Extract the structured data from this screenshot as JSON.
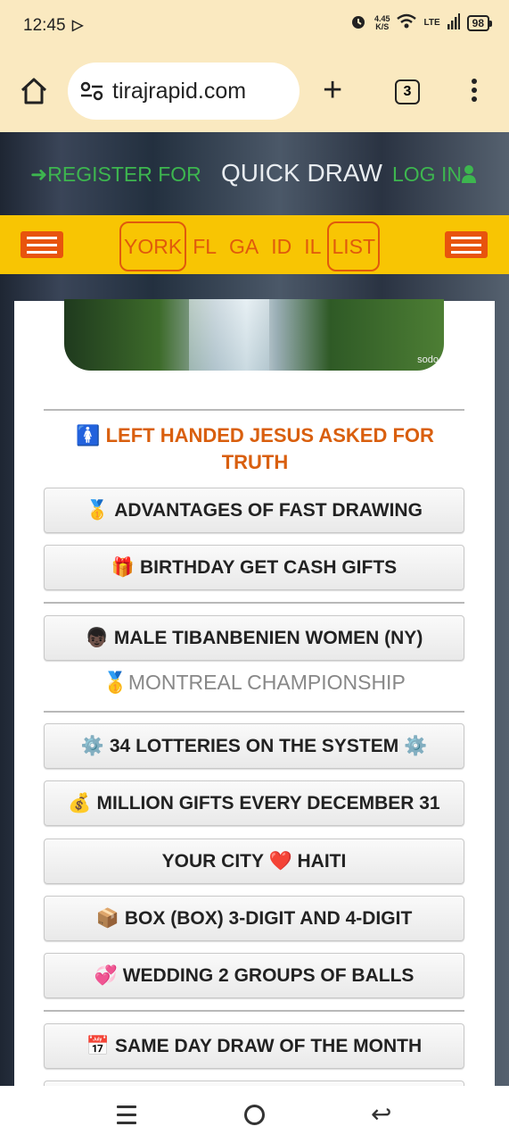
{
  "status": {
    "time": "12:45",
    "left_icon": "b-icon",
    "speed_value": "4.45",
    "speed_unit": "K/S",
    "network": "LTE",
    "battery": "98"
  },
  "browser": {
    "url": "tirajrapid.com",
    "tab_count": "3"
  },
  "topnav": {
    "register": "REGISTER FOR",
    "title": "QUICK DRAW",
    "login": "LOG IN"
  },
  "ynav": [
    "YORK",
    "FL",
    "GA",
    "ID",
    "IL",
    "LIST"
  ],
  "hero": {
    "credit": "sodo"
  },
  "headline": {
    "icon": "🚺",
    "text": "LEFT HANDED JESUS ASKED FOR TRUTH"
  },
  "buttons": [
    {
      "icon": "🥇",
      "label": "ADVANTAGES OF FAST DRAWING"
    },
    {
      "icon": "🎁",
      "label": "BIRTHDAY GET CASH GIFTS"
    },
    {
      "icon": "👦🏿",
      "label": "MALE TIBANBENIEN WOMEN (NY)"
    },
    {
      "icon": "⚙️",
      "label": "34 LOTTERIES ON THE SYSTEM",
      "icon_end": "⚙️"
    },
    {
      "icon": "💰",
      "label": "MILLION GIFTS EVERY DECEMBER 31"
    },
    {
      "label_pre": "YOUR CITY",
      "icon": "❤️",
      "label": "HAITI"
    },
    {
      "icon": "📦",
      "label": "BOX (BOX) 3-DIGIT AND 4-DIGIT"
    },
    {
      "icon": "💞",
      "label": "WEDDING 2 GROUPS OF BALLS"
    },
    {
      "icon": "📅",
      "label": "SAME DAY DRAW OF THE MONTH"
    }
  ],
  "plain": {
    "icon": "🥇",
    "text": "MONTREAL CHAMPIONSHIP"
  }
}
